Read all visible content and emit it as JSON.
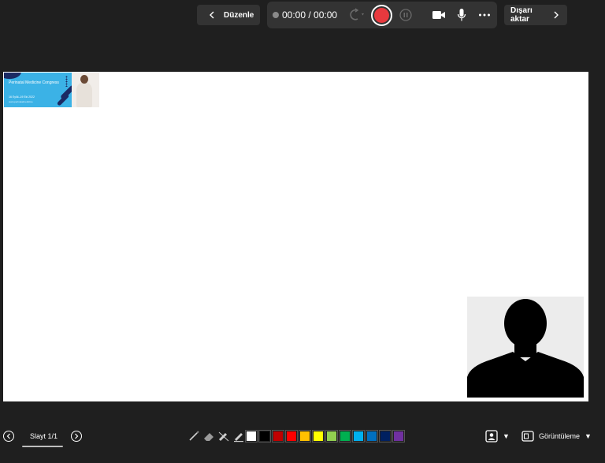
{
  "toolbar": {
    "edit_label": "Düzenle",
    "export_label": "Dışarı aktar",
    "timer": "00:00 / 00:00",
    "icons": {
      "back": "chevron-left-icon",
      "forward": "chevron-right-icon",
      "retake": "retake-icon",
      "record": "record-icon",
      "pause": "pause-icon",
      "camera": "camera-icon",
      "microphone": "microphone-icon",
      "more": "more-icon"
    }
  },
  "slide": {
    "banner": {
      "title": "Perinatal Medicine Congress",
      "date": "16 Eylül–19 Eki 2022",
      "url": "www.perinatalmedicine"
    },
    "camera_icon": "person-silhouette-icon"
  },
  "bottom_bar": {
    "slide_counter": "Slayt 1/1",
    "view_label": "Görüntüleme",
    "pens": [
      "pen-icon",
      "eraser-icon",
      "highlighter-icon",
      "marker-icon"
    ],
    "colors": [
      "#ffffff",
      "#000000",
      "#c00000",
      "#ff0000",
      "#ffc000",
      "#ffff00",
      "#92d050",
      "#00b050",
      "#00b0f0",
      "#0070c0",
      "#002060",
      "#7030a0"
    ]
  },
  "theme": {
    "background": "#1f1f1f",
    "toolbar_bg": "#333333",
    "record_color": "#e8393e"
  }
}
